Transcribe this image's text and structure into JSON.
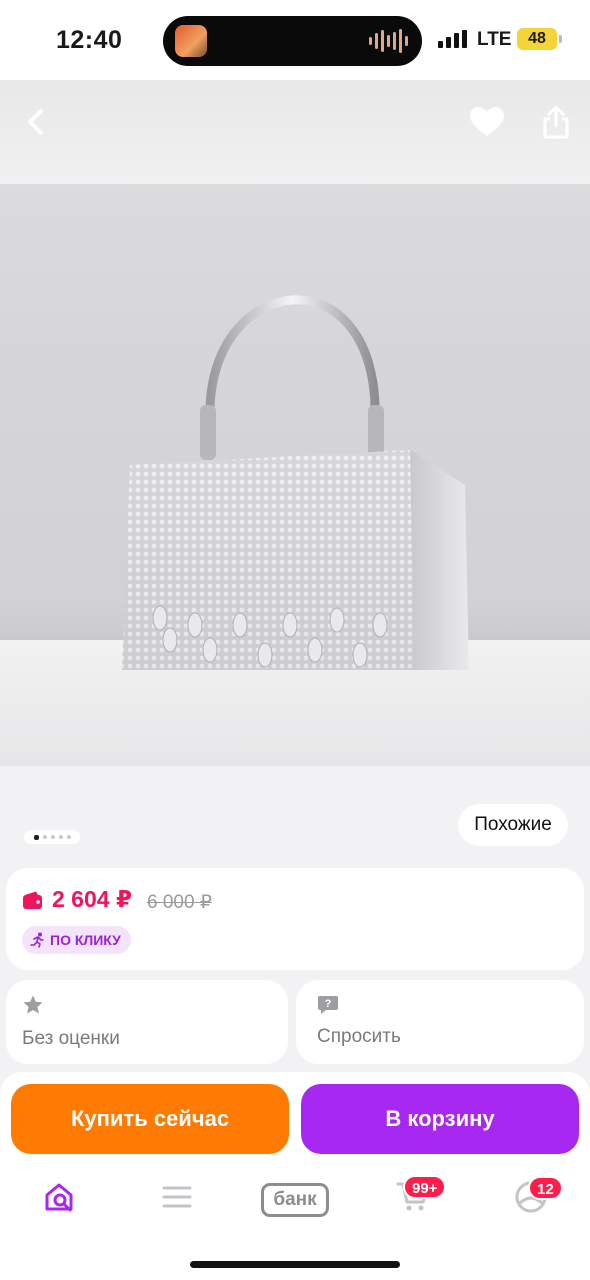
{
  "status_bar": {
    "time": "12:40",
    "network": "LTE",
    "battery": "48"
  },
  "product": {
    "images_count": 5,
    "current_image": 1,
    "similar_label": "Похожие"
  },
  "price": {
    "current": "2 604 ₽",
    "old": "6 000 ₽",
    "promo_label": "ПО КЛИКУ",
    "accent_color": "#f0135f"
  },
  "info": {
    "rating_label": "Без оценки",
    "ask_label": "Спросить"
  },
  "actions": {
    "buy_now_label": "Купить сейчас",
    "add_to_cart_label": "В корзину",
    "buy_color": "#ff7a00",
    "cart_color": "#a728f0"
  },
  "tabbar": {
    "bank_label": "банк",
    "cart_badge": "99+",
    "profile_badge": "12",
    "active_color": "#a728f0"
  },
  "icons": [
    "back-icon",
    "heart-icon",
    "share-icon",
    "wallet-icon",
    "star-icon",
    "question-icon",
    "home-search-icon",
    "catalog-icon",
    "cart-icon",
    "profile-icon"
  ]
}
